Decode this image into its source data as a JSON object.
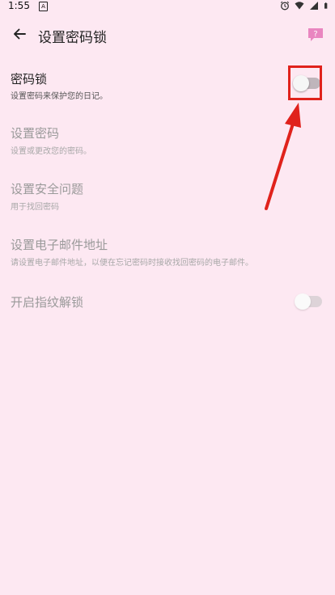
{
  "status_bar": {
    "time": "1:55",
    "app_indicator": "A",
    "icons": [
      "alarm-icon",
      "wifi-icon",
      "signal-icon",
      "battery-icon"
    ]
  },
  "app_bar": {
    "back_icon": "back-arrow-icon",
    "title": "设置密码锁",
    "help_icon": "help-icon"
  },
  "settings": [
    {
      "id": "password-lock",
      "title": "密码锁",
      "subtitle": "设置密码来保护您的日记。",
      "has_toggle": true,
      "toggle_on": false,
      "enabled": true
    },
    {
      "id": "set-password",
      "title": "设置密码",
      "subtitle": "设置或更改您的密码。",
      "has_toggle": false,
      "enabled": false
    },
    {
      "id": "security-question",
      "title": "设置安全问题",
      "subtitle": "用于找回密码",
      "has_toggle": false,
      "enabled": false
    },
    {
      "id": "email-address",
      "title": "设置电子邮件地址",
      "subtitle": "请设置电子邮件地址，以便在忘记密码时接收找回密码的电子邮件。",
      "has_toggle": false,
      "enabled": false
    },
    {
      "id": "fingerprint-unlock",
      "title": "开启指纹解锁",
      "subtitle": "",
      "has_toggle": true,
      "toggle_on": false,
      "enabled": false
    }
  ],
  "colors": {
    "background": "#fde8f2",
    "highlight": "#e0221c",
    "help_icon": "#e986c0"
  }
}
